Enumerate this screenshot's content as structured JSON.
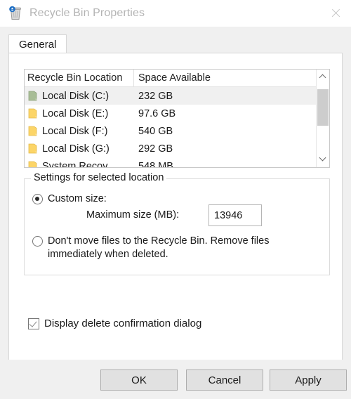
{
  "window": {
    "title": "Recycle Bin Properties",
    "icon": "recycle-bin-icon",
    "close_label": "✕"
  },
  "tabs": [
    {
      "label": "General",
      "active": true
    }
  ],
  "listview": {
    "columns": [
      "Recycle Bin Location",
      "Space Available"
    ],
    "rows": [
      {
        "location": "Local Disk (C:)",
        "space": "232 GB",
        "selected": true,
        "icon_color": "#a8bd96"
      },
      {
        "location": "Local Disk (E:)",
        "space": "97.6 GB",
        "selected": false,
        "icon_color": "#fcd568"
      },
      {
        "location": "Local Disk (F:)",
        "space": "540 GB",
        "selected": false,
        "icon_color": "#fcd568"
      },
      {
        "location": "Local Disk (G:)",
        "space": "292 GB",
        "selected": false,
        "icon_color": "#fcd568"
      },
      {
        "location": "System Recov",
        "space": "548 MB",
        "selected": false,
        "icon_color": "#fcd568"
      }
    ],
    "scrollbar": {
      "up_icon": "chevron-up-icon",
      "down_icon": "chevron-down-icon"
    }
  },
  "settings": {
    "group_title": "Settings for selected location",
    "custom_size": {
      "label": "Custom size:",
      "checked": true
    },
    "maximum_size": {
      "label": "Maximum size (MB):",
      "value": "13946"
    },
    "no_recycle": {
      "label": "Don't move files to the Recycle Bin. Remove files immediately when deleted.",
      "checked": false
    }
  },
  "confirmation": {
    "label": "Display delete confirmation dialog",
    "checked": true
  },
  "footer": {
    "ok": "OK",
    "cancel": "Cancel",
    "apply": "Apply"
  },
  "colors": {
    "dialog_background": "#f0f0f0",
    "panel_background": "#ffffff",
    "title_text": "#b4b4b4",
    "text": "#1a1a1a",
    "selection": "#f0f0f0",
    "button_face": "#e1e1e1",
    "button_border": "#adadad"
  }
}
